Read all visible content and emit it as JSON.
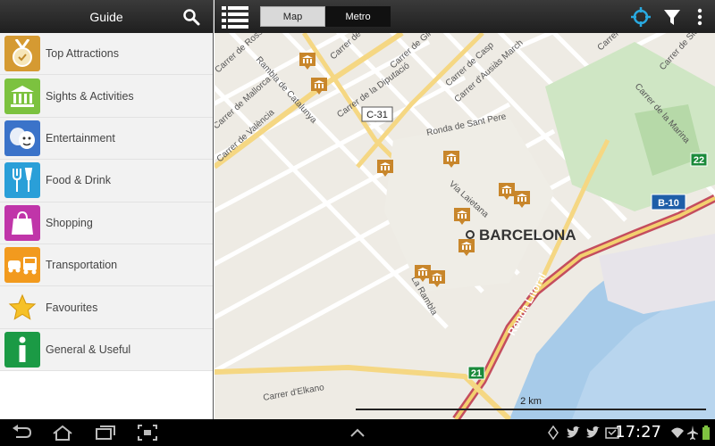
{
  "sidebar": {
    "title": "Guide",
    "items": [
      {
        "label": "Top Attractions",
        "icon": "medal-icon",
        "color": "#d59a32"
      },
      {
        "label": "Sights & Activities",
        "icon": "museum-icon",
        "color": "#7cc23f"
      },
      {
        "label": "Entertainment",
        "icon": "theater-masks-icon",
        "color": "#3b73c9"
      },
      {
        "label": "Food & Drink",
        "icon": "fork-knife-icon",
        "color": "#2a9fd8"
      },
      {
        "label": "Shopping",
        "icon": "shopping-bag-icon",
        "color": "#c035a9"
      },
      {
        "label": "Transportation",
        "icon": "bus-car-icon",
        "color": "#f29a1e"
      },
      {
        "label": "Favourites",
        "icon": "star-icon",
        "color": "#f2f2f2"
      },
      {
        "label": "General & Useful",
        "icon": "info-icon",
        "color": "#1b9a45"
      }
    ]
  },
  "topbar": {
    "tab_map": "Map",
    "tab_metro": "Metro"
  },
  "map": {
    "city_label": "BARCELONA",
    "road_c31": "C-31",
    "road_b10": "B-10",
    "exit_22": "22",
    "exit_21": "21",
    "street_1": "Carrer de Balmes",
    "street_2": "Carrer de Girona",
    "street_3": "Carrer de la Diputació",
    "street_4": "Carrer de Casp",
    "street_5": "Ronda de Sant Pere",
    "street_6": "Via Laietana",
    "street_7": "Rambla de Catalunya",
    "street_8": "Carrer de Mallorca",
    "street_9": "Carrer de València",
    "street_10": "Ronda Litoral",
    "street_11": "Carrer d'Elkano",
    "street_12": "Carrer de Sicília",
    "street_13": "Carrer de la Marina",
    "street_14": "Carrer de Rosselló",
    "street_15": "Carrer de Pamplona",
    "street_16": "Carrer d'Ausiàs March",
    "street_17": "La Rambla",
    "scale": "2 km"
  },
  "status": {
    "time": "17:27"
  }
}
